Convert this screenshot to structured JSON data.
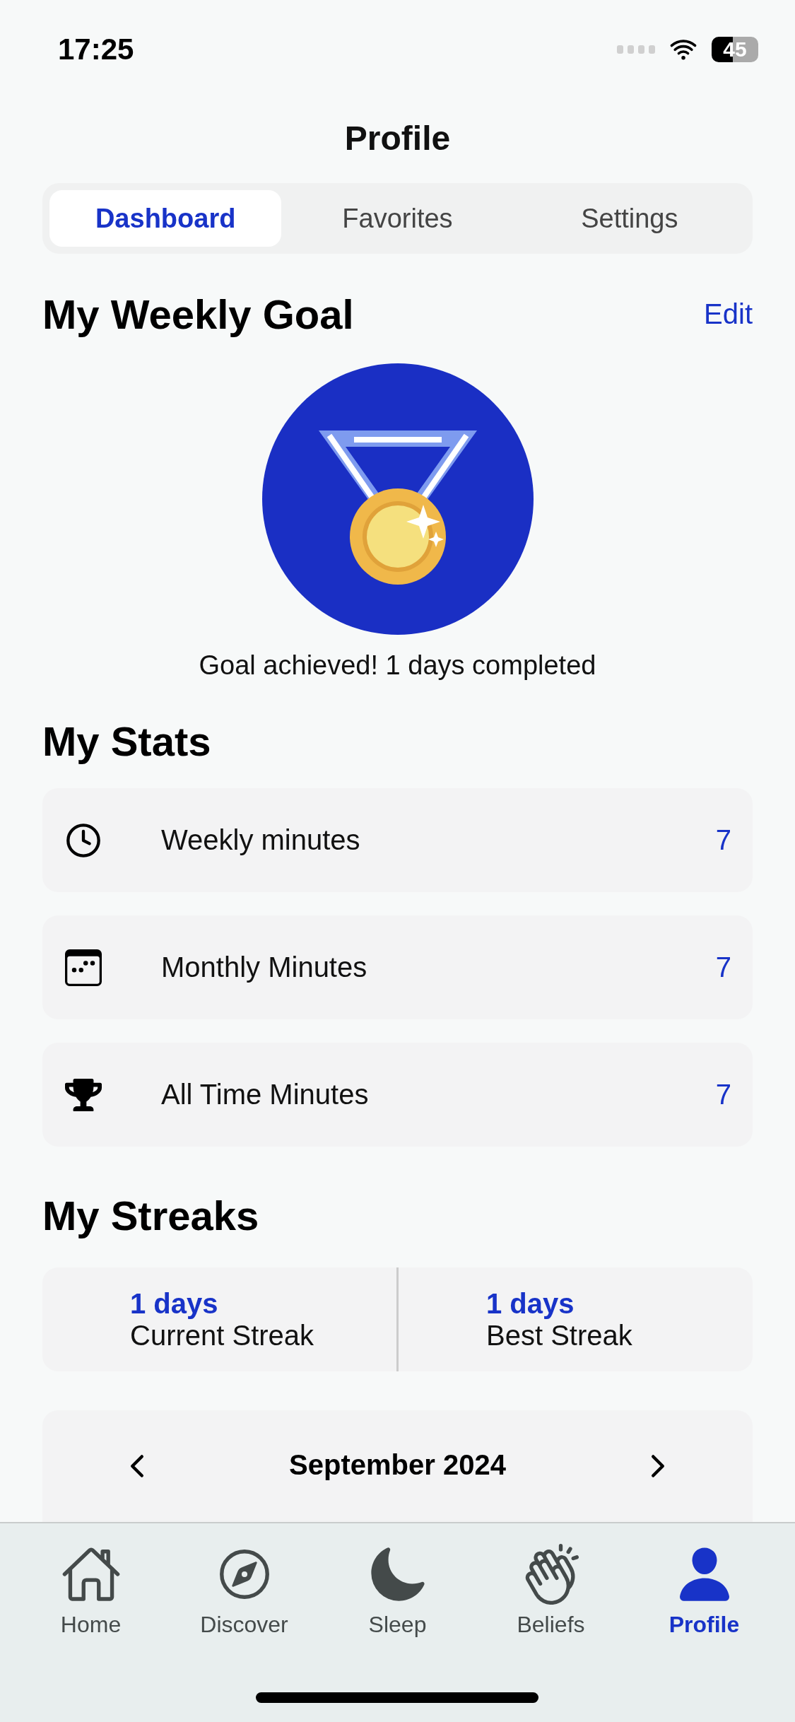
{
  "status_bar": {
    "time": "17:25",
    "battery": "45"
  },
  "title": "Profile",
  "tabs": [
    {
      "label": "Dashboard",
      "selected": true
    },
    {
      "label": "Favorites",
      "selected": false
    },
    {
      "label": "Settings",
      "selected": false
    }
  ],
  "weekly_goal": {
    "heading": "My Weekly Goal",
    "edit": "Edit",
    "caption": "Goal achieved! 1 days completed"
  },
  "stats": {
    "heading": "My Stats",
    "items": [
      {
        "label": "Weekly minutes",
        "value": "7"
      },
      {
        "label": "Monthly Minutes",
        "value": "7"
      },
      {
        "label": "All Time Minutes",
        "value": "7"
      }
    ]
  },
  "streaks": {
    "heading": "My Streaks",
    "items": [
      {
        "value": "1 days",
        "label": "Current Streak"
      },
      {
        "value": "1 days",
        "label": "Best Streak"
      }
    ]
  },
  "calendar": {
    "month": "September 2024"
  },
  "tab_bar": [
    {
      "label": "Home",
      "selected": false
    },
    {
      "label": "Discover",
      "selected": false
    },
    {
      "label": "Sleep",
      "selected": false
    },
    {
      "label": "Beliefs",
      "selected": false
    },
    {
      "label": "Profile",
      "selected": true
    }
  ]
}
